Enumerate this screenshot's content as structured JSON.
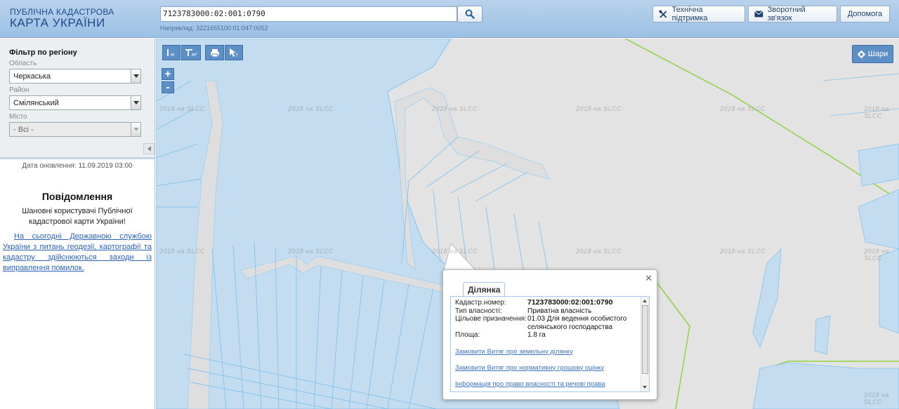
{
  "header": {
    "logo_line1": "ПУБЛІЧНА КАДАСТРОВА",
    "logo_line2": "КАРТА УКРАЇНИ",
    "search_value": "7123783000:02:001:0790",
    "search_hint": "Наприклад: 3221655100:01:047:0052",
    "buttons": {
      "support": "Технічна підтримка",
      "feedback": "Зворотний зв'язок",
      "help": "Допомога"
    }
  },
  "sidebar": {
    "filter_title": "Фільтр по регіону",
    "region_label": "Область",
    "region_value": "Черкаська",
    "district_label": "Район",
    "district_value": "Смілянський",
    "city_label": "Місто",
    "city_value": "- Всі -",
    "updated": "Дата оновлення: 11.09.2019 03:00",
    "notice_title": "Повідомлення",
    "notice_body": "Шановні користувачі Публічної кадастрової карти України!",
    "notice_link": "На сьогодні Державною службою України з питань геодезії, картографії та кадастру здійснюються заходи із виправлення помилок."
  },
  "map": {
    "layers_label": "Шари",
    "zoom_in": "+",
    "zoom_out": "-",
    "watermark": "2018 на SLCC",
    "tools": [
      "ruler-icon",
      "area-measure-icon",
      "print-icon",
      "identify-icon"
    ]
  },
  "popup": {
    "tab": "Ділянка",
    "rows": [
      {
        "k": "Кадастр.номер:",
        "v": "7123783000:02:001:0790"
      },
      {
        "k": "Тип власності:",
        "v": "Приватна власність"
      },
      {
        "k": "Цільове призначення:",
        "v": "01.03 Для ведення особистого селянського господарства"
      },
      {
        "k": "Площа:",
        "v": "1.8 га"
      }
    ],
    "links": [
      "Замовити Витяг про земельну ділянку",
      "Замовити Витяг про нормативну грошову оцінку",
      "Інформація про право власності та речові права"
    ]
  },
  "colors": {
    "parcel_fill": "#c3dcef",
    "parcel_line": "#84c3ee",
    "boundary_green": "#8fd33f",
    "map_bg": "#e3e3e3"
  }
}
